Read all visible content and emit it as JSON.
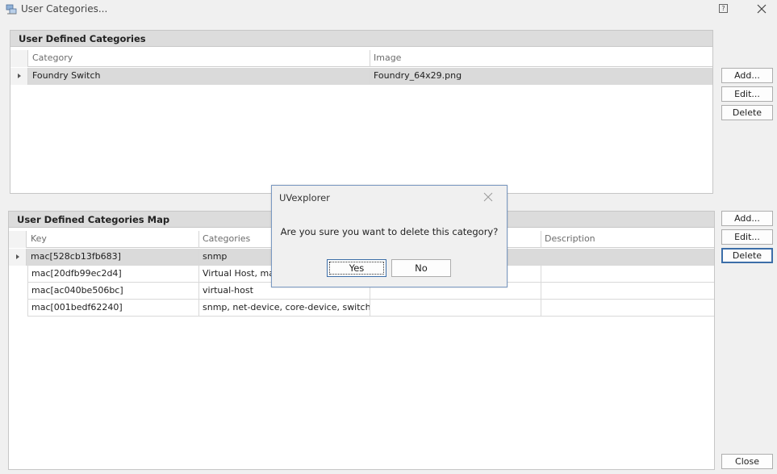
{
  "window": {
    "title": "User Categories...",
    "help_label": "?",
    "icons": {
      "app": "categories-app-icon",
      "close": "close-icon"
    }
  },
  "categories_panel": {
    "header": "User Defined Categories",
    "columns": [
      "Category",
      "Image"
    ],
    "rows": [
      {
        "category": "Foundry Switch",
        "image": "Foundry_64x29.png",
        "selected": true
      }
    ],
    "buttons": {
      "add": "Add...",
      "edit": "Edit...",
      "delete": "Delete"
    }
  },
  "map_panel": {
    "header": "User Defined Categories Map",
    "columns": [
      "Key",
      "Categories",
      "",
      "Description"
    ],
    "rows": [
      {
        "key": "mac[528cb13fb683]",
        "categories": "snmp",
        "col3": "",
        "description": "",
        "selected": true
      },
      {
        "key": "mac[20dfb99ec2d4]",
        "categories": "Virtual Host, manu",
        "col3": "",
        "description": ""
      },
      {
        "key": "mac[ac040be506bc]",
        "categories": "virtual-host",
        "col3": "",
        "description": ""
      },
      {
        "key": "mac[001bedf62240]",
        "categories": "snmp, net-device, core-device, switch, ...",
        "col3": "",
        "description": ""
      }
    ],
    "buttons": {
      "add": "Add...",
      "edit": "Edit...",
      "delete": "Delete"
    }
  },
  "footer": {
    "close_label": "Close"
  },
  "dialog": {
    "title": "UVexplorer",
    "message": "Are you sure you want to delete this category?",
    "yes_label": "Yes",
    "no_label": "No"
  }
}
